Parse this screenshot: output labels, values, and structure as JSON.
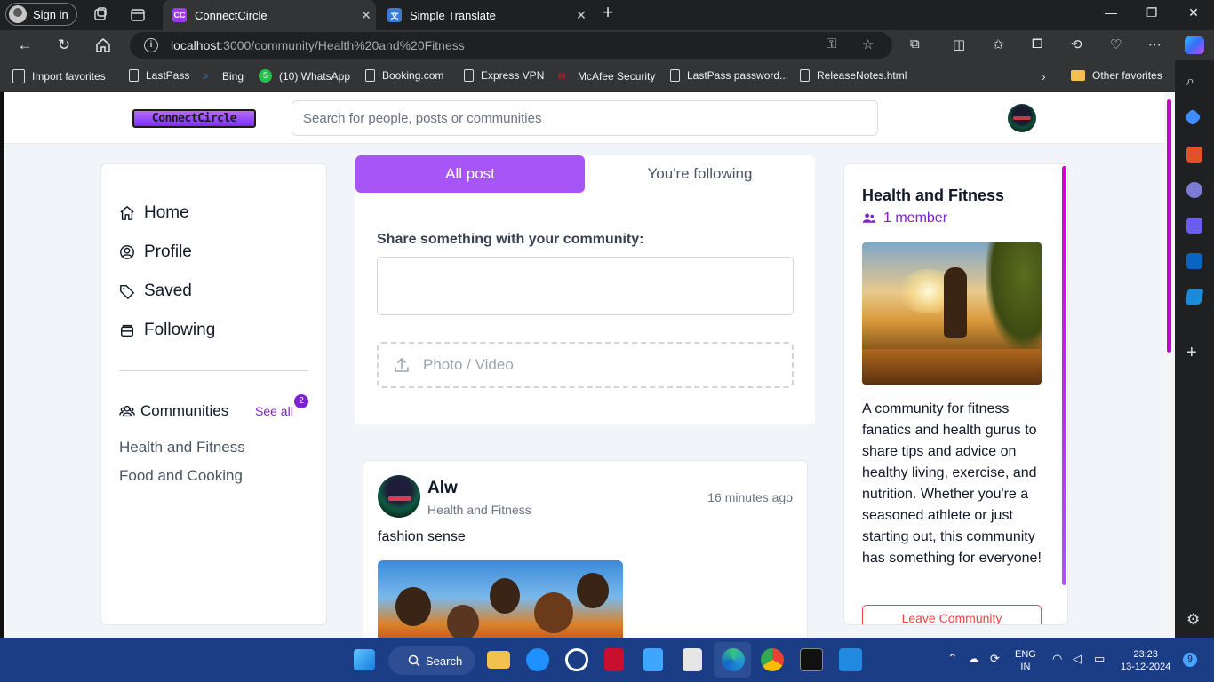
{
  "browser": {
    "signin_label": "Sign in",
    "tabs": [
      {
        "title": "ConnectCircle",
        "favicon": "CC",
        "active": true
      },
      {
        "title": "Simple Translate",
        "favicon": "translate",
        "active": false
      }
    ],
    "url_host": "localhost",
    "url_rest": ":3000/community/Health%20and%20Fitness",
    "bookmarks": [
      {
        "label": "Import favorites",
        "icon": "import-icon"
      },
      {
        "label": "LastPass",
        "icon": "doc-icon"
      },
      {
        "label": "Bing",
        "icon": "search-icon"
      },
      {
        "label": "(10) WhatsApp",
        "icon": "whatsapp-icon"
      },
      {
        "label": "Booking.com",
        "icon": "doc-icon"
      },
      {
        "label": "Express VPN",
        "icon": "doc-icon"
      },
      {
        "label": "McAfee Security",
        "icon": "mcafee-icon"
      },
      {
        "label": "LastPass password...",
        "icon": "doc-icon"
      },
      {
        "label": "ReleaseNotes.html",
        "icon": "doc-icon"
      }
    ],
    "other_favorites": "Other favorites"
  },
  "app": {
    "logo_text": "ConnectCircle",
    "search_placeholder": "Search for people, posts or communities"
  },
  "left": {
    "nav": [
      {
        "label": "Home",
        "icon": "home-icon"
      },
      {
        "label": "Profile",
        "icon": "user-circle-icon"
      },
      {
        "label": "Saved",
        "icon": "tag-icon"
      },
      {
        "label": "Following",
        "icon": "inbox-icon"
      }
    ],
    "communities_label": "Communities",
    "see_all": "See all",
    "see_all_badge": "2",
    "communities": [
      "Health and Fitness",
      "Food and Cooking"
    ]
  },
  "feed": {
    "tab_all": "All post",
    "tab_following": "You're following",
    "share_label": "Share something with your community:",
    "upload_label": "Photo / Video",
    "post": {
      "author": "Alw",
      "community": "Health and Fitness",
      "time": "16 minutes ago",
      "text": "fashion sense"
    }
  },
  "community": {
    "title": "Health and Fitness",
    "members": "1 member",
    "description": "A community for fitness fanatics and health gurus to share tips and advice on healthy living, exercise, and nutrition. Whether you're a seasoned athlete or just starting out, this community has something for everyone!",
    "leave_button": "Leave Community"
  },
  "taskbar": {
    "search_label": "Search",
    "lang_top": "ENG",
    "lang_bottom": "IN",
    "time": "23:23",
    "date": "13-12-2024",
    "notif_count": "9"
  },
  "colors": {
    "accent": "#a855f7",
    "accent_text": "#7e22ce",
    "danger": "#ef4444",
    "page_bg": "#f1f5f9"
  }
}
